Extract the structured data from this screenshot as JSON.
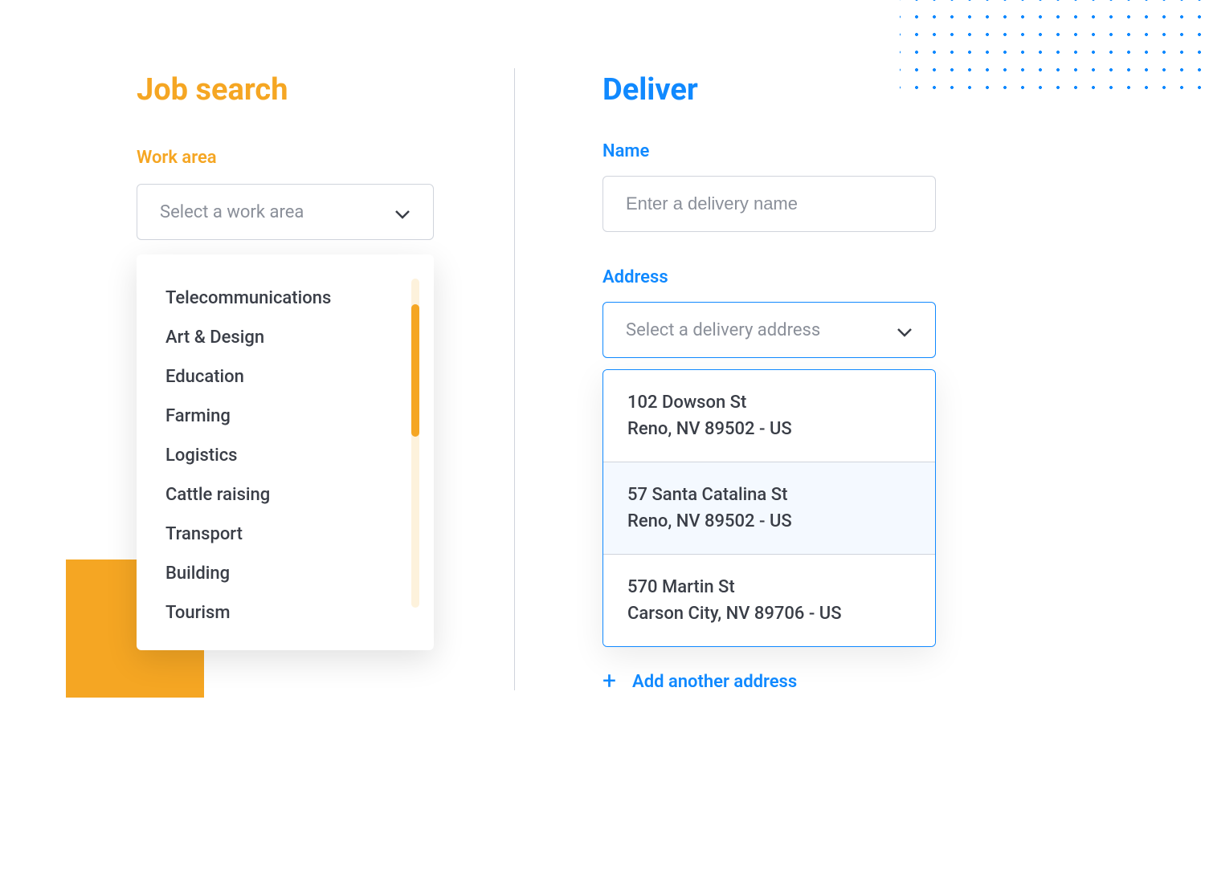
{
  "jobSearch": {
    "heading": "Job search",
    "workAreaLabel": "Work area",
    "selectPlaceholder": "Select a work area",
    "options": [
      "Telecommunications",
      "Art & Design",
      "Education",
      "Farming",
      "Logistics",
      "Cattle raising",
      "Transport",
      "Building",
      "Tourism"
    ]
  },
  "deliver": {
    "heading": "Deliver",
    "nameLabel": "Name",
    "namePlaceholder": "Enter a delivery name",
    "addressLabel": "Address",
    "selectPlaceholder": "Select a delivery address",
    "addresses": [
      {
        "line1": "102 Dowson St",
        "line2": "Reno, NV 89502 - US",
        "selected": false
      },
      {
        "line1": "57 Santa Catalina St",
        "line2": "Reno, NV 89502 - US",
        "selected": true
      },
      {
        "line1": "570 Martin St",
        "line2": "Carson City, NV 89706 - US",
        "selected": false
      }
    ],
    "addAnotherLabel": "Add another address"
  }
}
